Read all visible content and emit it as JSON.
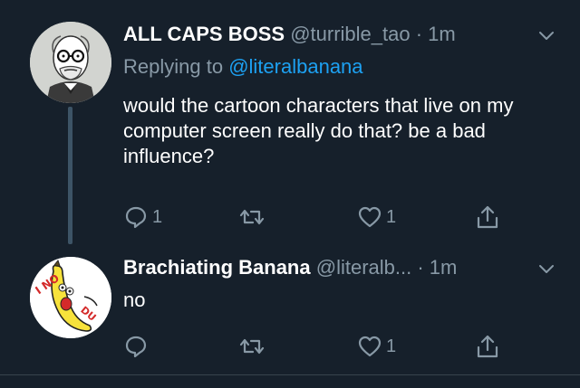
{
  "tweets": [
    {
      "display_name": "ALL CAPS BOSS",
      "handle": "@turrible_tao",
      "time": "· 1m",
      "reply_prefix": "Replying to",
      "reply_to": "@literalbanana",
      "text": "would the cartoon characters that live on my computer screen really do that? be a bad influence?",
      "reply_count": "1",
      "retweet_count": "",
      "like_count": "1",
      "avatar_icon": "old-man-glasses-avatar"
    },
    {
      "display_name": "Brachiating Banana",
      "handle": "@literalb...",
      "time": "· 1m",
      "text": "no",
      "reply_count": "",
      "retweet_count": "",
      "like_count": "1",
      "avatar_icon": "cartoon-banana-avatar",
      "avatar_text": "I NO DU"
    }
  ],
  "colors": {
    "background": "#16202b",
    "secondary_text": "#8899a6",
    "link": "#1da1f2",
    "thread_line": "#3d5466"
  }
}
